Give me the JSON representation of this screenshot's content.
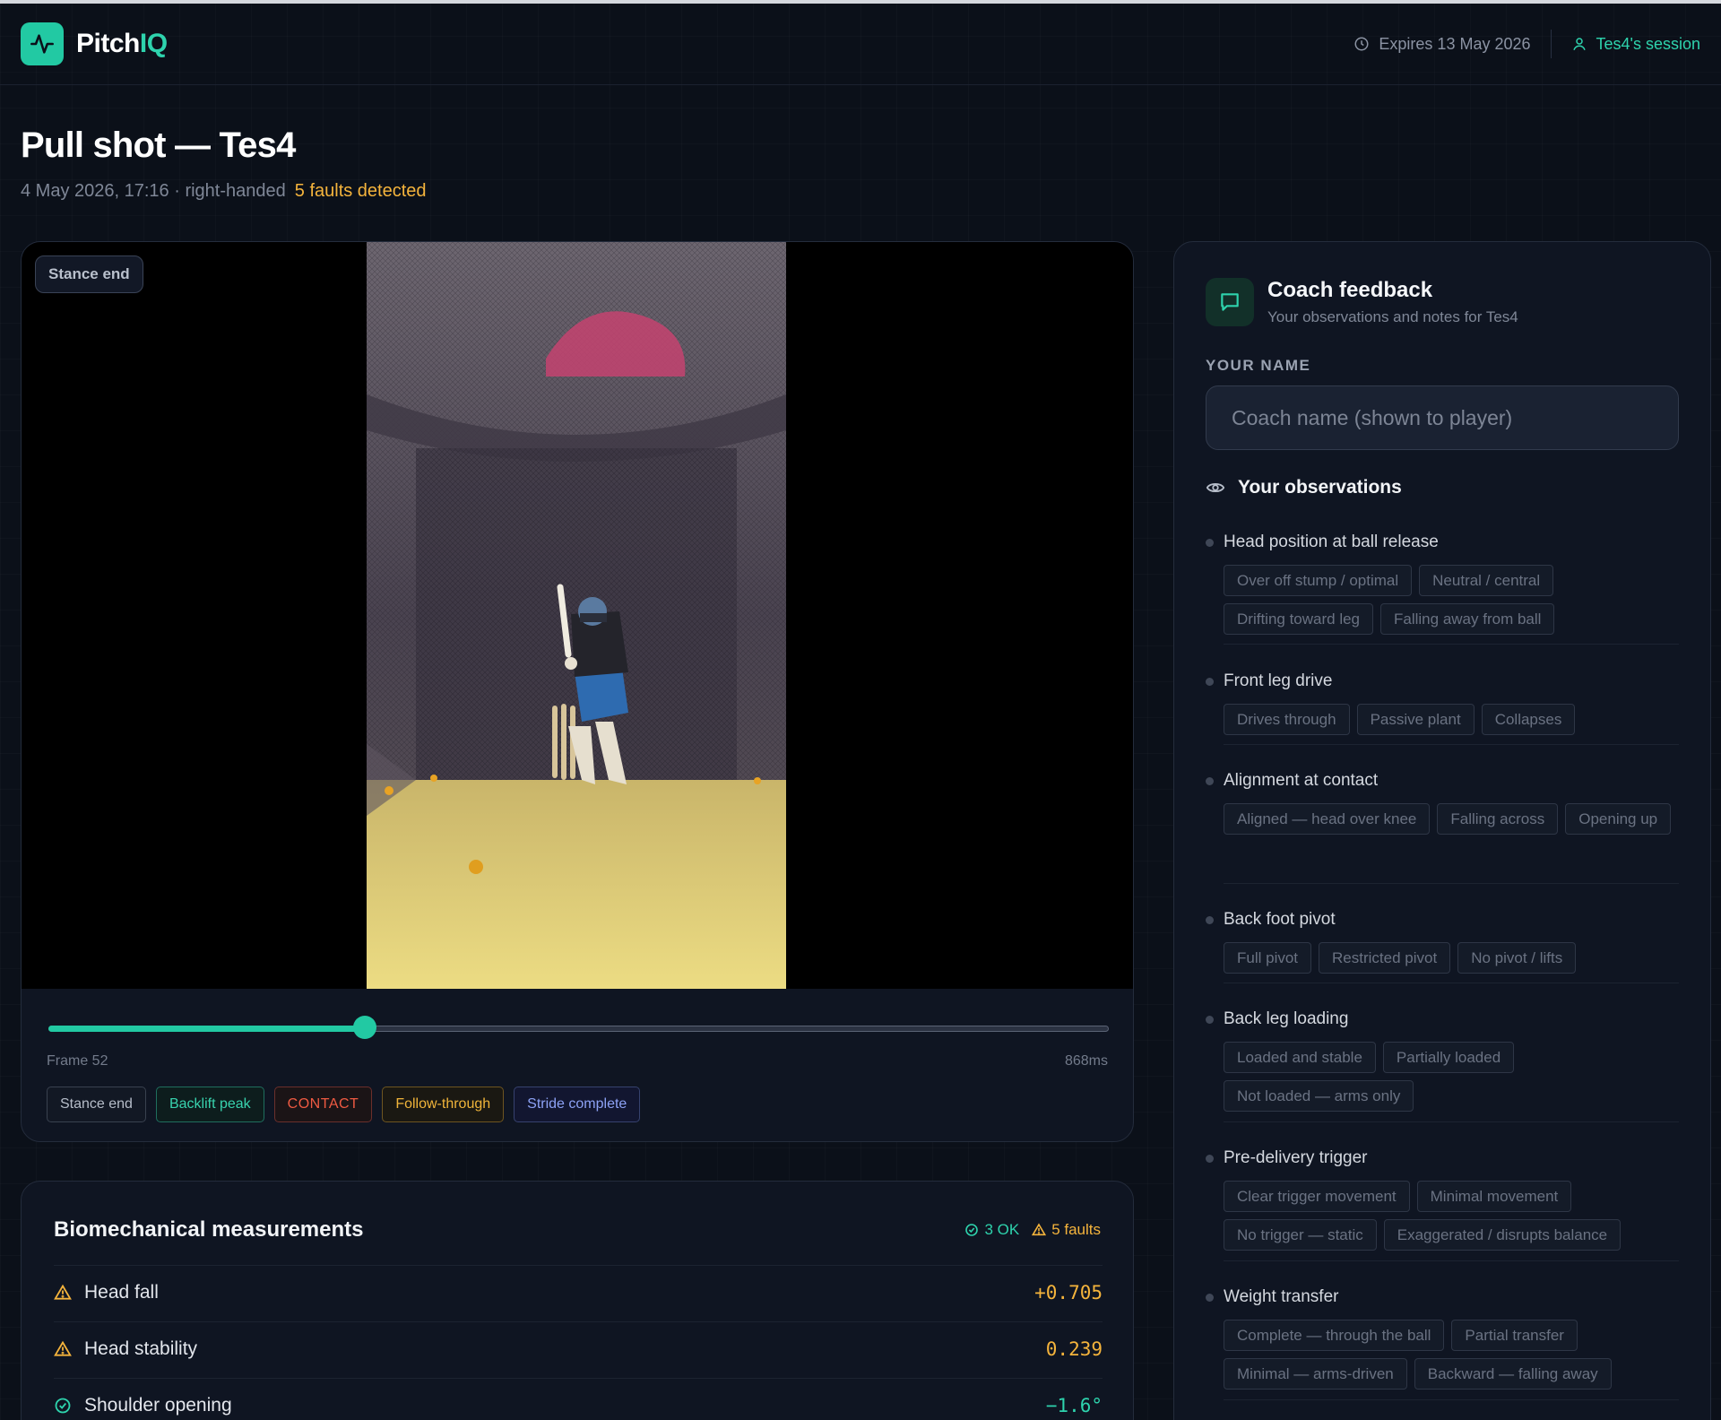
{
  "brand": {
    "part1": "Pitch",
    "part2": "IQ"
  },
  "header": {
    "expires": "Expires 13 May 2026",
    "session": "Tes4's session"
  },
  "page": {
    "title": "Pull shot — Tes4",
    "subtitle": "4 May 2026, 17:16 · right-handed",
    "faults": "5 faults detected"
  },
  "video": {
    "phase_label": "Stance end",
    "frame_label": "Frame 52",
    "time_label": "868ms",
    "progress": 0.298,
    "phases": [
      "Stance end",
      "Backlift peak",
      "CONTACT",
      "Follow-through",
      "Stride complete"
    ]
  },
  "biomech": {
    "title": "Biomechanical measurements",
    "ok_count": "3 OK",
    "fault_count": "5 faults",
    "rows": [
      {
        "name": "Head fall",
        "value": "+0.705",
        "status": "fault"
      },
      {
        "name": "Head stability",
        "value": "0.239",
        "status": "fault"
      },
      {
        "name": "Shoulder opening",
        "value": "−1.6°",
        "status": "ok"
      }
    ]
  },
  "coach": {
    "title": "Coach feedback",
    "subtitle": "Your observations and notes for Tes4",
    "name_label": "YOUR NAME",
    "name_placeholder": "Coach name (shown to player)",
    "observations_title": "Your observations",
    "groups": [
      {
        "question": "Head position at ball release",
        "options": [
          "Over off stump / optimal",
          "Neutral / central",
          "Drifting toward leg",
          "Falling away from ball"
        ]
      },
      {
        "question": "Front leg drive",
        "options": [
          "Drives through",
          "Passive plant",
          "Collapses"
        ]
      },
      {
        "question": "Alignment at contact",
        "options": [
          "Aligned — head over knee",
          "Falling across",
          "Opening up"
        ]
      },
      {
        "question": "Back foot pivot",
        "options": [
          "Full pivot",
          "Restricted pivot",
          "No pivot / lifts"
        ]
      },
      {
        "question": "Back leg loading",
        "options": [
          "Loaded and stable",
          "Partially loaded",
          "Not loaded — arms only"
        ]
      },
      {
        "question": "Pre-delivery trigger",
        "options": [
          "Clear trigger movement",
          "Minimal movement",
          "No trigger — static",
          "Exaggerated / disrupts balance"
        ]
      },
      {
        "question": "Weight transfer",
        "options": [
          "Complete — through the ball",
          "Partial transfer",
          "Minimal — arms-driven",
          "Backward — falling away"
        ]
      }
    ]
  }
}
